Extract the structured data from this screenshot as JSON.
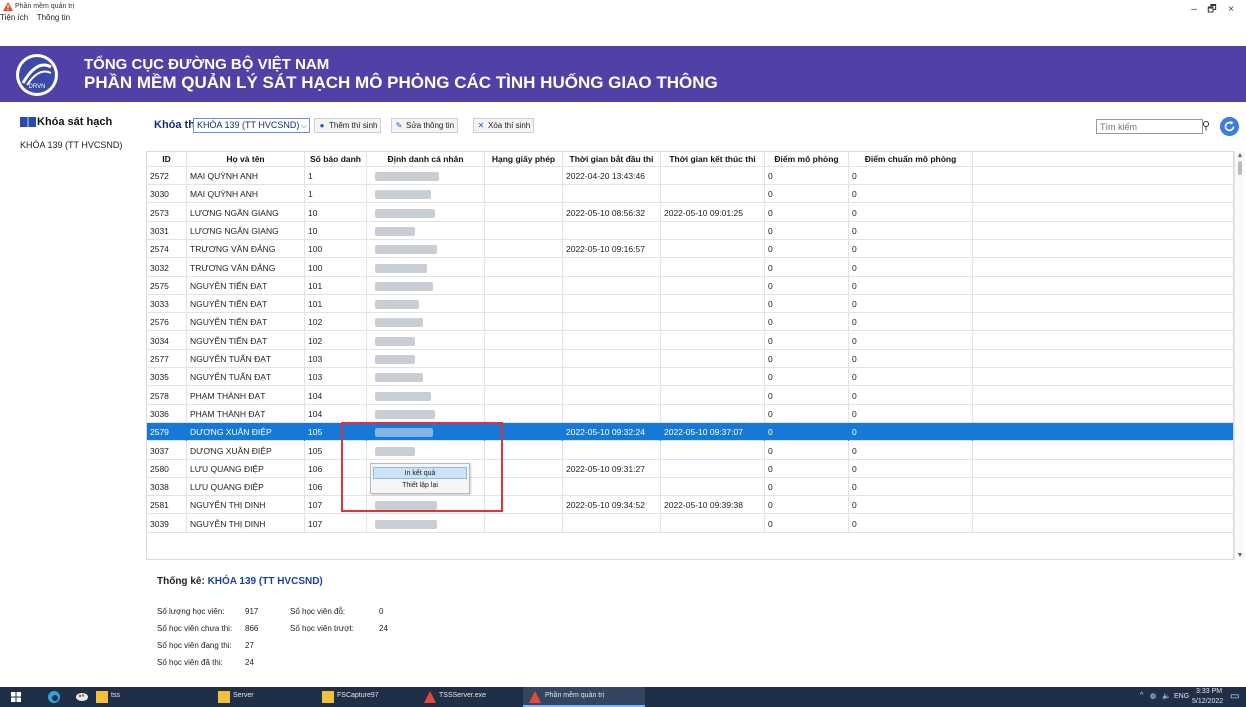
{
  "window": {
    "title": "Phần mềm quản trị",
    "minimize": "–",
    "maximize": "🗗",
    "close": "×"
  },
  "menu": [
    "Tiện ích",
    "Thông tin"
  ],
  "banner": {
    "line1": "TỔNG CỤC ĐƯỜNG BỘ VIỆT NAM",
    "line2": "PHẦN MỀM QUẢN LÝ SÁT HẠCH MÔ PHỎNG CÁC TÌNH HUỐNG GIAO THÔNG",
    "logo_text": "DRVN"
  },
  "sidebar": {
    "heading": "Khóa sát hạch",
    "items": [
      "KHÓA 139 (TT HVCSND)"
    ]
  },
  "toolbar": {
    "label": "Khóa thi",
    "combo_value": "KHÓA 139 (TT HVCSND)",
    "add_label": "Thêm thí sinh",
    "edit_label": "Sửa thông tin",
    "delete_label": "Xóa thí sinh",
    "search_placeholder": "Tìm kiếm"
  },
  "table": {
    "columns": [
      "ID",
      "Họ và tên",
      "Số báo danh",
      "Định danh cá nhân",
      "Hạng giấy phép",
      "Thời gian bắt đầu thi",
      "Thời gian kết thúc thi",
      "Điểm mô phỏng",
      "Điểm chuẩn mô phỏng"
    ],
    "rows": [
      {
        "id": "2572",
        "name": "MAI QUỲNH ANH",
        "sbd": "1",
        "start": "2022-04-20 13:43:46",
        "end": "",
        "score": "0",
        "pass": "0"
      },
      {
        "id": "3030",
        "name": "MAI QUỲNH ANH",
        "sbd": "1",
        "start": "",
        "end": "",
        "score": "0",
        "pass": "0"
      },
      {
        "id": "2573",
        "name": "LƯƠNG NGÂN GIANG",
        "sbd": "10",
        "start": "2022-05-10 08:56:32",
        "end": "2022-05-10 09:01:25",
        "score": "0",
        "pass": "0"
      },
      {
        "id": "3031",
        "name": "LƯƠNG NGÂN GIANG",
        "sbd": "10",
        "start": "",
        "end": "",
        "score": "0",
        "pass": "0"
      },
      {
        "id": "2574",
        "name": "TRƯƠNG VĂN ĐẢNG",
        "sbd": "100",
        "start": "2022-05-10 09:16:57",
        "end": "",
        "score": "0",
        "pass": "0"
      },
      {
        "id": "3032",
        "name": "TRƯƠNG VĂN ĐẢNG",
        "sbd": "100",
        "start": "",
        "end": "",
        "score": "0",
        "pass": "0"
      },
      {
        "id": "2575",
        "name": "NGUYỄN TIẾN ĐẠT",
        "sbd": "101",
        "start": "",
        "end": "",
        "score": "0",
        "pass": "0"
      },
      {
        "id": "3033",
        "name": "NGUYỄN TIẾN ĐẠT",
        "sbd": "101",
        "start": "",
        "end": "",
        "score": "0",
        "pass": "0"
      },
      {
        "id": "2576",
        "name": "NGUYỄN TIẾN ĐẠT",
        "sbd": "102",
        "start": "",
        "end": "",
        "score": "0",
        "pass": "0"
      },
      {
        "id": "3034",
        "name": "NGUYỄN TIẾN ĐẠT",
        "sbd": "102",
        "start": "",
        "end": "",
        "score": "0",
        "pass": "0"
      },
      {
        "id": "2577",
        "name": "NGUYỄN TUẤN ĐẠT",
        "sbd": "103",
        "start": "",
        "end": "",
        "score": "0",
        "pass": "0"
      },
      {
        "id": "3035",
        "name": "NGUYỄN TUẤN ĐẠT",
        "sbd": "103",
        "start": "",
        "end": "",
        "score": "0",
        "pass": "0"
      },
      {
        "id": "2578",
        "name": "PHẠM THÀNH ĐẠT",
        "sbd": "104",
        "start": "",
        "end": "",
        "score": "0",
        "pass": "0"
      },
      {
        "id": "3036",
        "name": "PHẠM THÀNH ĐẠT",
        "sbd": "104",
        "start": "",
        "end": "",
        "score": "0",
        "pass": "0"
      },
      {
        "id": "2579",
        "name": "DƯƠNG XUÂN ĐIỆP",
        "sbd": "105",
        "start": "2022-05-10 09:32:24",
        "end": "2022-05-10 09:37:07",
        "score": "0",
        "pass": "0",
        "selected": true
      },
      {
        "id": "3037",
        "name": "DƯƠNG XUÂN ĐIỆP",
        "sbd": "105",
        "start": "",
        "end": "",
        "score": "0",
        "pass": "0"
      },
      {
        "id": "2580",
        "name": "LƯU QUANG ĐIỆP",
        "sbd": "106",
        "start": "2022-05-10 09:31:27",
        "end": "",
        "score": "0",
        "pass": "0"
      },
      {
        "id": "3038",
        "name": "LƯU QUANG ĐIỆP",
        "sbd": "106",
        "start": "",
        "end": "",
        "score": "0",
        "pass": "0"
      },
      {
        "id": "2581",
        "name": "NGUYỄN THỊ DINH",
        "sbd": "107",
        "start": "2022-05-10 09:34:52",
        "end": "2022-05-10 09:39:38",
        "score": "0",
        "pass": "0"
      },
      {
        "id": "3039",
        "name": "NGUYỄN THỊ DINH",
        "sbd": "107",
        "start": "",
        "end": "",
        "score": "0",
        "pass": "0"
      }
    ]
  },
  "context_menu": {
    "items": [
      "In kết quả",
      "Thiết lập lại"
    ]
  },
  "stats": {
    "title_prefix": "Thống kê:",
    "course": "KHÓA 139 (TT HVCSND)",
    "total_label": "Số lượng học viên:",
    "total": "917",
    "not_taken_label": "Số học viên chưa thi:",
    "not_taken": "866",
    "taking_label": "Số học viên đang thi:",
    "taking": "27",
    "taken_label": "Số học viên đã thi:",
    "taken": "24",
    "passed_label": "Số học viên đỗ:",
    "passed": "0",
    "failed_label": "Số học viên trượt:",
    "failed": "24"
  },
  "taskbar": {
    "items": [
      "tss",
      "Server",
      "FSCapture97",
      "TSSServer.exe",
      "Phần mềm quản trị"
    ],
    "lang": "ENG",
    "time": "3:33 PM",
    "date": "5/12/2022"
  },
  "colors": {
    "banner": "#5140a6",
    "selection": "#1779d7",
    "highlight_box": "#e0323a",
    "taskbar": "#1f2f47"
  }
}
